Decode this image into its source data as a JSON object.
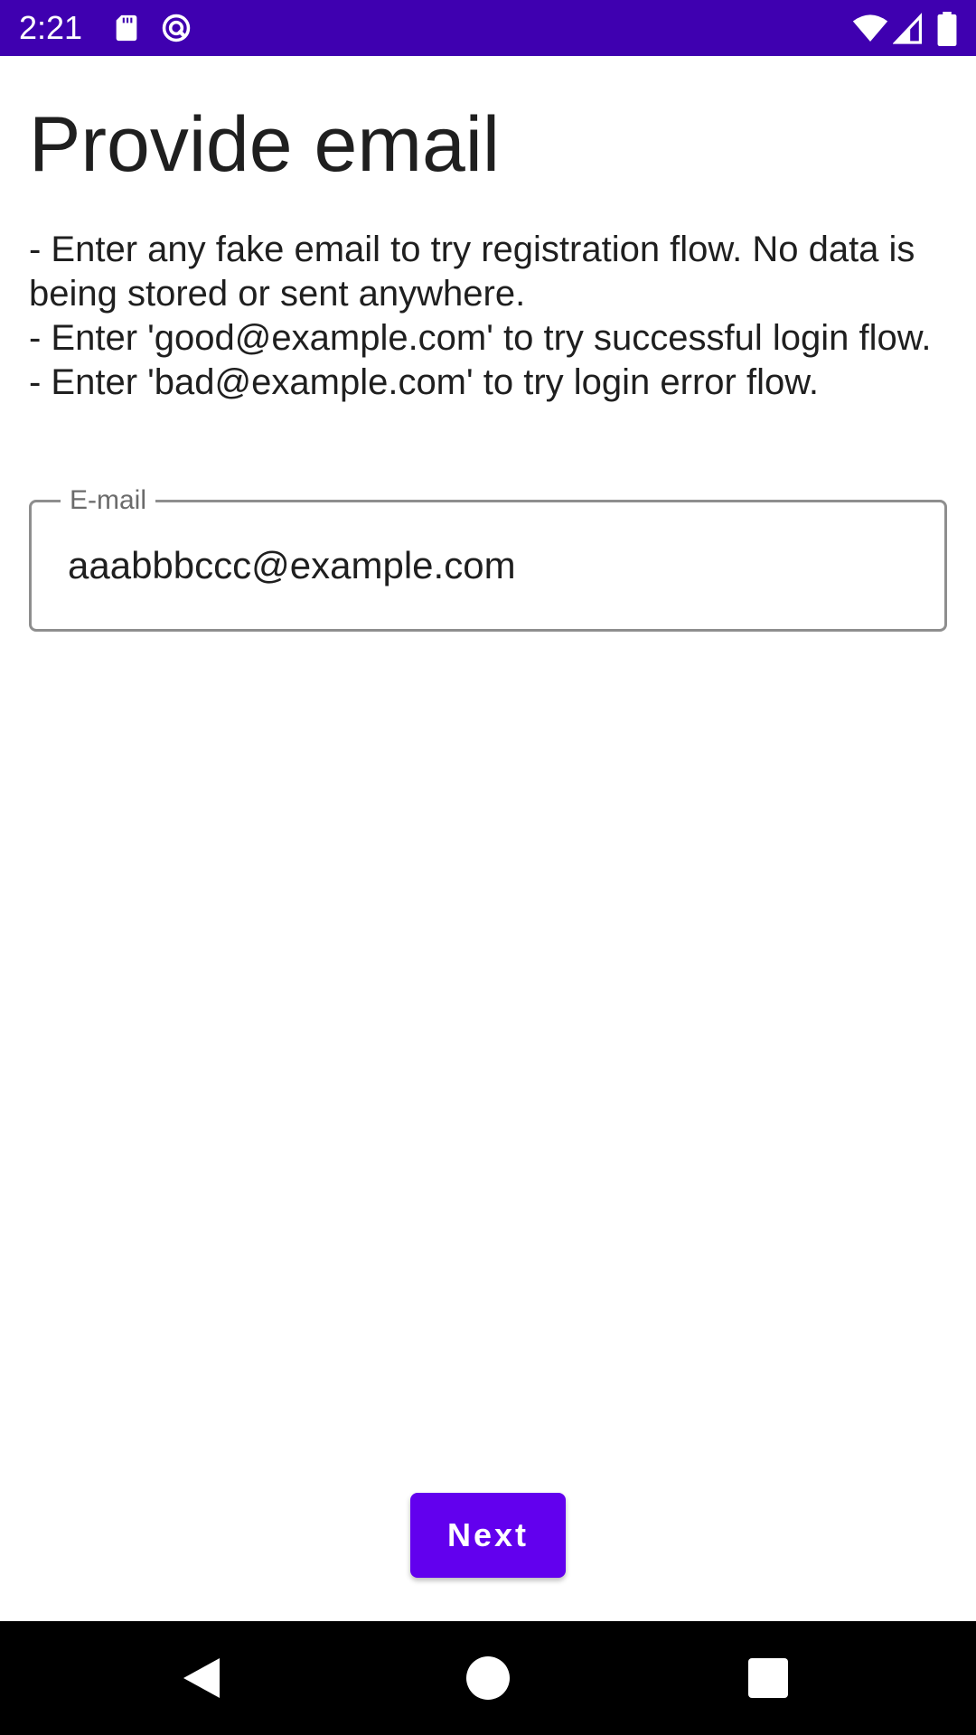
{
  "status_bar": {
    "time": "2:21",
    "background": "#3f00b0",
    "left_icons": [
      "sd-card-icon",
      "sync-icon"
    ],
    "right_icons": [
      "wifi-icon",
      "cell-signal-icon",
      "battery-icon"
    ]
  },
  "screen": {
    "title": "Provide email",
    "instructions": [
      "- Enter any fake email to try registration flow. No data is being stored or sent anywhere.",
      "- Enter 'good@example.com' to try successful login flow.",
      "- Enter 'bad@example.com' to try login error flow."
    ],
    "email_field": {
      "label": "E-mail",
      "value": "aaabbbccc@example.com"
    },
    "next_button": {
      "label": "Next",
      "color": "#6200ee"
    }
  },
  "nav_bar": {
    "icons": [
      "back-icon",
      "home-icon",
      "recents-icon"
    ]
  }
}
